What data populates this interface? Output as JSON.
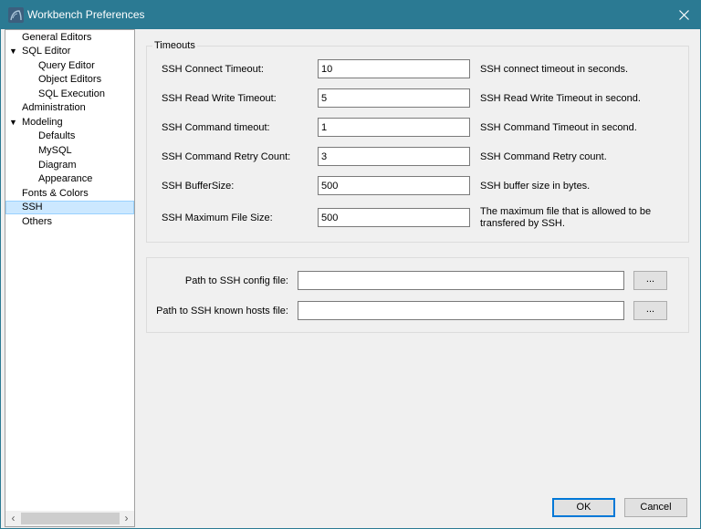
{
  "window": {
    "title": "Workbench Preferences",
    "app_icon": "mysql-workbench-dolphin-icon",
    "close_icon": "close-icon"
  },
  "sidebar": {
    "items": [
      {
        "label": "General Editors",
        "level": 0,
        "expanded": null,
        "selected": false
      },
      {
        "label": "SQL Editor",
        "level": 0,
        "expanded": true,
        "selected": false
      },
      {
        "label": "Query Editor",
        "level": 1,
        "expanded": null,
        "selected": false
      },
      {
        "label": "Object Editors",
        "level": 1,
        "expanded": null,
        "selected": false
      },
      {
        "label": "SQL Execution",
        "level": 1,
        "expanded": null,
        "selected": false
      },
      {
        "label": "Administration",
        "level": 0,
        "expanded": null,
        "selected": false
      },
      {
        "label": "Modeling",
        "level": 0,
        "expanded": true,
        "selected": false
      },
      {
        "label": "Defaults",
        "level": 1,
        "expanded": null,
        "selected": false
      },
      {
        "label": "MySQL",
        "level": 1,
        "expanded": null,
        "selected": false
      },
      {
        "label": "Diagram",
        "level": 1,
        "expanded": null,
        "selected": false
      },
      {
        "label": "Appearance",
        "level": 1,
        "expanded": null,
        "selected": false
      },
      {
        "label": "Fonts & Colors",
        "level": 0,
        "expanded": null,
        "selected": false
      },
      {
        "label": "SSH",
        "level": 0,
        "expanded": null,
        "selected": true
      },
      {
        "label": "Others",
        "level": 0,
        "expanded": null,
        "selected": false
      }
    ],
    "expand_glyph": "▼",
    "scroll_left": "‹",
    "scroll_right": "›"
  },
  "timeouts": {
    "title": "Timeouts",
    "rows": [
      {
        "label": "SSH Connect Timeout:",
        "value": "10",
        "description": "SSH connect timeout in seconds."
      },
      {
        "label": "SSH Read Write Timeout:",
        "value": "5",
        "description": "SSH Read Write Timeout in second."
      },
      {
        "label": "SSH Command timeout:",
        "value": "1",
        "description": "SSH Command Timeout in second."
      },
      {
        "label": "SSH Command Retry Count:",
        "value": "3",
        "description": "SSH Command Retry count."
      },
      {
        "label": "SSH BufferSize:",
        "value": "500",
        "description": "SSH buffer size in bytes."
      },
      {
        "label": "SSH Maximum File Size:",
        "value": "500",
        "description": "The maximum file that is allowed to be transfered by SSH."
      }
    ]
  },
  "paths": {
    "config_label": "Path to SSH config file:",
    "config_value": "",
    "known_hosts_label": "Path to SSH known hosts file:",
    "known_hosts_value": "",
    "browse_label": "..."
  },
  "footer": {
    "ok_label": "OK",
    "cancel_label": "Cancel"
  },
  "colors": {
    "titlebar": "#2b7a93",
    "selection": "#cce8ff",
    "default_button_border": "#0078d7"
  }
}
